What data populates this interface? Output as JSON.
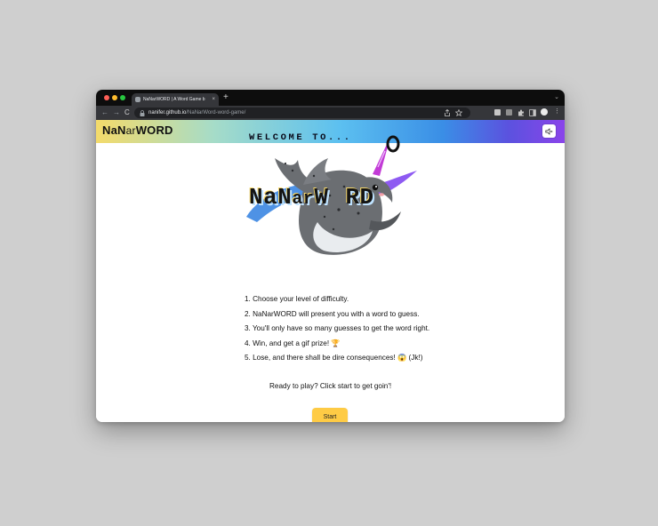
{
  "browser": {
    "tab_title": "NaNarWORD | A Word Game b",
    "tab_close": "×",
    "new_tab": "+",
    "tabs_menu": "⌄",
    "nav_back": "←",
    "nav_forward": "→",
    "nav_reload": "C",
    "url_host": "nanifer.github.io",
    "url_path": "/NaNarWord-word-game/"
  },
  "app": {
    "brand_part1": "NaN",
    "brand_part2": "ar",
    "brand_part3": "WORD"
  },
  "hero": {
    "welcome_text": "WELCOME TO...",
    "logo_part1": "NaN",
    "logo_part2": "ar",
    "logo_part3": "W",
    "logo_part4": "RD"
  },
  "instructions": [
    "1. Choose your level of difficulty.",
    "2. NaNarWORD will present you with a word to guess.",
    "3. You'll only have so many guesses to get the word right.",
    "4. Win, and get a gif prize! 🏆",
    "5. Lose, and there shall be dire consequences! 😱 (Jk!)"
  ],
  "ready_text": "Ready to play? Click start to get goin'!",
  "start_label": "Start",
  "colors": {
    "start_button": "#fecb45",
    "gradient": [
      "#f4db6a",
      "#5cc0f0",
      "#8a44ea"
    ]
  },
  "icons": {
    "sound": "speaker-muted-icon",
    "lock": "lock-icon",
    "share": "share-icon",
    "star": "star-icon",
    "extensions": "puzzle-icon",
    "profile": "avatar",
    "menu": "kebab-menu-icon"
  }
}
